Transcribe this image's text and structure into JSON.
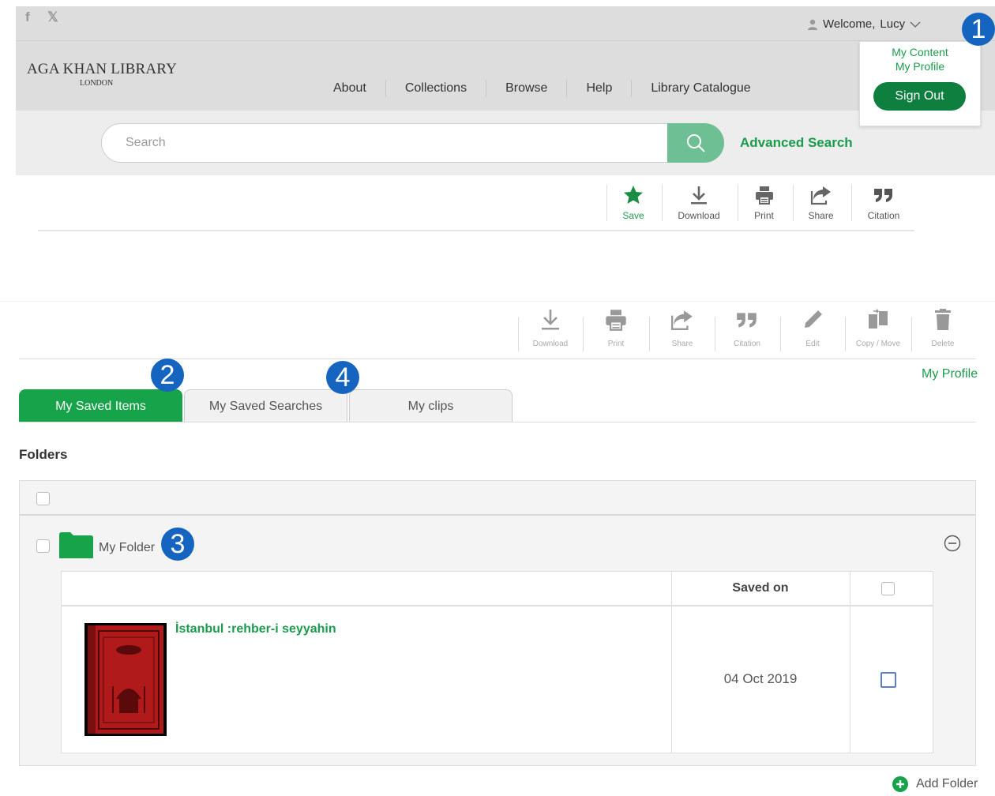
{
  "header": {
    "welcome_prefix": "Welcome,",
    "user_name": "Lucy",
    "logo_main": "AGA KHAN LIBRARY",
    "logo_sub": "LONDON",
    "social": [
      "f",
      "𝕏"
    ]
  },
  "nav": {
    "items": [
      "About",
      "Collections",
      "Browse",
      "Help",
      "Library Catalogue"
    ]
  },
  "user_menu": {
    "my_content": "My Content",
    "my_profile": "My Profile",
    "sign_out": "Sign Out"
  },
  "search": {
    "placeholder": "Search",
    "advanced": "Advanced Search"
  },
  "toolbar_top": {
    "save": "Save",
    "download": "Download",
    "print": "Print",
    "share": "Share",
    "citation": "Citation"
  },
  "toolbar_items": {
    "download": "Download",
    "print": "Print",
    "share": "Share",
    "citation": "Citation",
    "edit": "Edit",
    "copy_move": "Copy / Move",
    "delete": "Delete"
  },
  "profile_link": "My Profile",
  "tabs": [
    {
      "label": "My Saved Items",
      "active": true
    },
    {
      "label": "My Saved Searches",
      "active": false
    },
    {
      "label": "My clips",
      "active": false
    }
  ],
  "folders": {
    "heading": "Folders",
    "folder_name": "My Folder",
    "table": {
      "saved_on_header": "Saved on",
      "rows": [
        {
          "title": "İstanbul :rehber-i seyyahin",
          "saved_on": "04 Oct 2019"
        }
      ]
    },
    "add_folder": "Add Folder"
  },
  "badges": [
    "1",
    "2",
    "3",
    "4"
  ],
  "colors": {
    "brand_green": "#1a9c4c",
    "tab_active": "#16a34a",
    "sign_out_bg": "#0e7f3f",
    "search_button": "#6fbf94",
    "badge_blue": "#1565c0"
  }
}
